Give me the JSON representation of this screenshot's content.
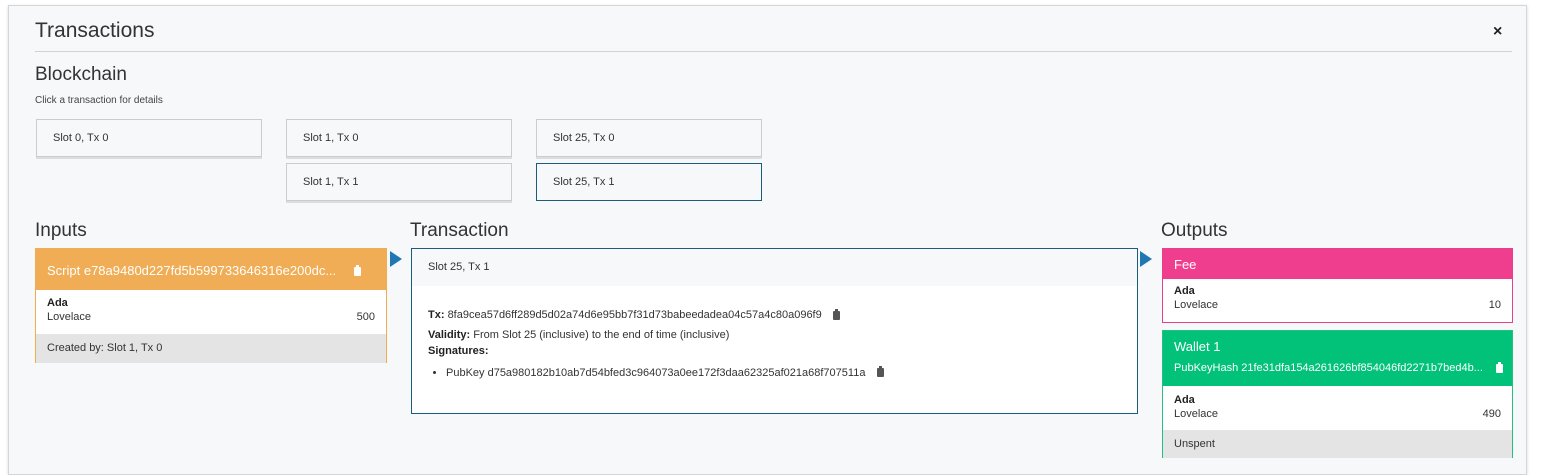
{
  "header": {
    "title": "Transactions",
    "close_label": "×"
  },
  "blockchain": {
    "title": "Blockchain",
    "hint": "Click a transaction for details",
    "slots": [
      {
        "label": "Slot 0, Tx 0"
      },
      {
        "label": "Slot 1, Tx 0"
      },
      {
        "label": "Slot 25, Tx 0"
      },
      {
        "label": "Slot 1, Tx 1"
      },
      {
        "label": "Slot 25, Tx 1"
      }
    ],
    "selected": "Slot 25, Tx 1"
  },
  "inputs": {
    "title": "Inputs",
    "card": {
      "header": "Script e78a9480d227fd5b599733646316e200dc...",
      "currency": "Ada",
      "token": "Lovelace",
      "amount": "500",
      "footer": "Created by: Slot 1, Tx 0",
      "color": "#f0ad55"
    }
  },
  "transaction": {
    "title": "Transaction",
    "header": "Slot 25, Tx 1",
    "tx_label": "Tx:",
    "tx_id": "8fa9cea57d6ff289d5d02a74d6e95bb7f31d73babeedadea04c57a4c80a096f9",
    "validity_label": "Validity:",
    "validity": "From Slot 25 (inclusive) to the end of time (inclusive)",
    "signatures_label": "Signatures:",
    "signatures": [
      "PubKey d75a980182b10ab7d54bfed3c964073a0ee172f3daa62325af021a68f707511a"
    ]
  },
  "outputs": {
    "title": "Outputs",
    "fee": {
      "header": "Fee",
      "currency": "Ada",
      "token": "Lovelace",
      "amount": "10",
      "color": "#f03e8e"
    },
    "wallet": {
      "header": "Wallet 1",
      "hash": "PubKeyHash 21fe31dfa154a261626bf854046fd2271b7bed4b...",
      "currency": "Ada",
      "token": "Lovelace",
      "amount": "490",
      "footer": "Unspent",
      "color": "#02c27a"
    }
  },
  "icons": {
    "copy": "clipboard-icon",
    "arrow": "triangle-right-icon"
  }
}
